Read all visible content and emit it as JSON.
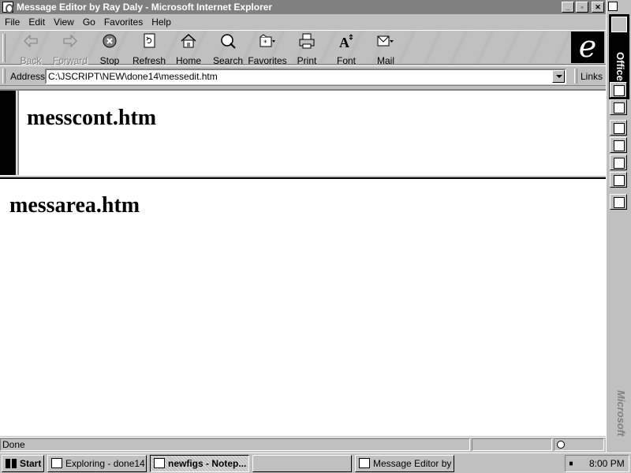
{
  "window": {
    "title": "Message Editor by Ray Daly - Microsoft Internet Explorer",
    "controls": [
      "_",
      "▫",
      "✕"
    ]
  },
  "menu": [
    "File",
    "Edit",
    "View",
    "Go",
    "Favorites",
    "Help"
  ],
  "toolbar": {
    "buttons": [
      {
        "label": "Back",
        "icon": "back-arrow-icon",
        "enabled": false
      },
      {
        "label": "Forward",
        "icon": "forward-arrow-icon",
        "enabled": false
      },
      {
        "label": "Stop",
        "icon": "stop-icon",
        "enabled": true
      },
      {
        "label": "Refresh",
        "icon": "refresh-icon",
        "enabled": true
      },
      {
        "label": "Home",
        "icon": "home-icon",
        "enabled": true
      },
      {
        "label": "Search",
        "icon": "search-icon",
        "enabled": true
      },
      {
        "label": "Favorites",
        "icon": "favorites-icon",
        "enabled": true
      },
      {
        "label": "Print",
        "icon": "print-icon",
        "enabled": true
      },
      {
        "label": "Font",
        "icon": "font-icon",
        "enabled": true
      },
      {
        "label": "Mail",
        "icon": "mail-icon",
        "enabled": true
      }
    ],
    "logo": "e"
  },
  "address": {
    "label": "Address",
    "value": "C:\\JSCRIPT\\NEW\\done14\\messedit.htm",
    "links_label": "Links"
  },
  "frames": {
    "top_heading": "messcont.htm",
    "bottom_heading": "messarea.htm"
  },
  "status": {
    "text": "Done"
  },
  "office_bar": {
    "title": "Office",
    "brand": "Microsoft",
    "buttons": [
      "new-document-icon",
      "open-document-icon",
      "new-message-icon",
      "appointment-icon",
      "task-icon",
      "contact-icon",
      "journal-icon"
    ]
  },
  "taskbar": {
    "start_label": "Start",
    "tasks": [
      {
        "label": "Exploring - done14",
        "icon": "explorer-icon",
        "active": false
      },
      {
        "label": "newfigs - Notep...",
        "icon": "notepad-icon",
        "active": true
      },
      {
        "label": "",
        "icon": "",
        "active": false
      },
      {
        "label": "Message Editor by ...",
        "icon": "ie-icon",
        "active": false
      }
    ],
    "clock": "8:00 PM"
  }
}
